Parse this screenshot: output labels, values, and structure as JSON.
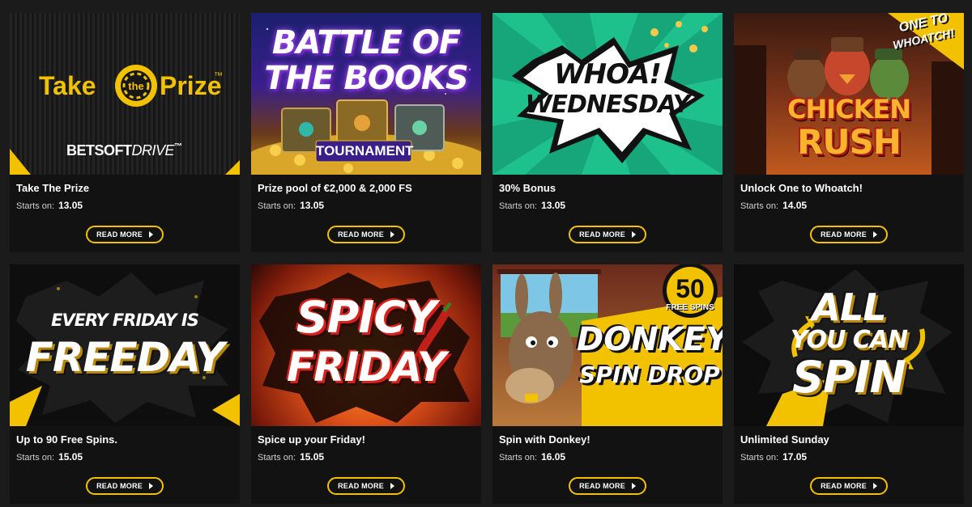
{
  "promotions": [
    {
      "title": "Take The Prize",
      "starts_label": "Starts on:",
      "date": "13.05",
      "button": "READ MORE",
      "banner": {
        "line1": "Take",
        "badge": "the",
        "line2": "Prize",
        "tm": "™",
        "brand_a": "BETSOFT",
        "brand_b": "DRIVE",
        "brand_tm": "™"
      }
    },
    {
      "title": "Prize pool of €2,000 & 2,000 FS",
      "starts_label": "Starts on:",
      "date": "13.05",
      "button": "READ MORE",
      "banner": {
        "line1": "BATTLE OF",
        "line2": "THE BOOKS",
        "tag": "TOURNAMENT"
      }
    },
    {
      "title": "30% Bonus",
      "starts_label": "Starts on:",
      "date": "13.05",
      "button": "READ MORE",
      "banner": {
        "line1": "WHOA!",
        "line2": "WEDNESDAY"
      }
    },
    {
      "title": "Unlock One to Whoatch!",
      "starts_label": "Starts on:",
      "date": "14.05",
      "button": "READ MORE",
      "banner": {
        "corner1": "ONE TO",
        "corner2": "WHOATCH!",
        "line1": "CHICKEN",
        "line2": "RUSH"
      }
    },
    {
      "title": "Up to 90 Free Spins.",
      "starts_label": "Starts on:",
      "date": "15.05",
      "button": "READ MORE",
      "banner": {
        "line1": "EVERY FRIDAY IS",
        "line2": "FREEDAY"
      }
    },
    {
      "title": "Spice up your Friday!",
      "starts_label": "Starts on:",
      "date": "15.05",
      "button": "READ MORE",
      "banner": {
        "line1": "SPICY",
        "line2": "FRIDAY"
      }
    },
    {
      "title": "Spin with Donkey!",
      "starts_label": "Starts on:",
      "date": "16.05",
      "button": "READ MORE",
      "banner": {
        "badge_num": "50",
        "badge_text": "FREE SPINS",
        "line1": "DONKEY",
        "line2": "SPIN DROP"
      }
    },
    {
      "title": "Unlimited Sunday",
      "starts_label": "Starts on:",
      "date": "17.05",
      "button": "READ MORE",
      "banner": {
        "line1": "ALL",
        "line2": "YOU CAN",
        "line3": "SPIN"
      }
    }
  ],
  "colors": {
    "accent": "#f2c200",
    "card_bg": "#121212",
    "page_bg": "#1b1b1b"
  },
  "icons": {
    "button_arrow": "play-arrow-icon"
  }
}
